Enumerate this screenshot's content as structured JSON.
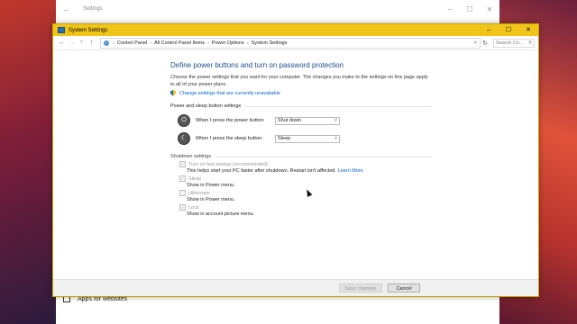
{
  "background_window": {
    "title": "Settings",
    "item_label": "Apps for websites"
  },
  "window": {
    "title": "System Settings",
    "controls": [
      "–",
      "☐",
      "✕"
    ]
  },
  "address_bar": {
    "breadcrumbs": [
      "Control Panel",
      "All Control Panel Items",
      "Power Options",
      "System Settings"
    ],
    "search_placeholder": "Search Co..."
  },
  "content": {
    "heading": "Define power buttons and turn on password protection",
    "description": "Choose the power settings that you want for your computer. The changes you make to the settings on this page apply to all of your power plans.",
    "admin_link": "Change settings that are currently unavailable",
    "power_section": "Power and sleep button settings",
    "power_button_label": "When I press the power button:",
    "power_button_value": "Shut down",
    "sleep_button_label": "When I press the sleep button:",
    "sleep_button_value": "Sleep",
    "shutdown_section": "Shutdown settings",
    "options": [
      {
        "label": "Turn on fast startup (recommended)",
        "desc": "This helps start your PC faster after shutdown. Restart isn't affected.",
        "link": "Learn More",
        "checked": true
      },
      {
        "label": "Sleep",
        "desc": "Show in Power menu.",
        "checked": true
      },
      {
        "label": "Hibernate",
        "desc": "Show in Power menu.",
        "checked": false
      },
      {
        "label": "Lock",
        "desc": "Show in account picture menu.",
        "checked": true
      }
    ]
  },
  "footer": {
    "save_label": "Save changes",
    "cancel_label": "Cancel"
  },
  "colors": {
    "titlebar": "#f0c419",
    "heading": "#1e4e8c",
    "link": "#0066cc"
  }
}
